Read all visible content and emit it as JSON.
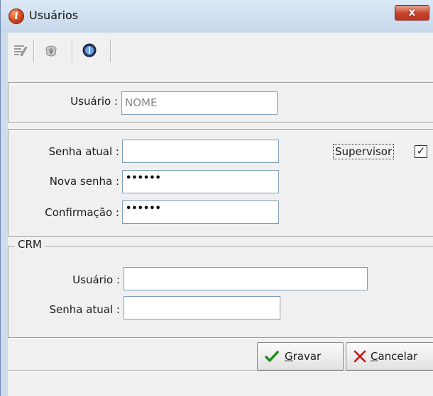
{
  "window": {
    "title": "Usuários",
    "close_label": "x"
  },
  "toolbar": {
    "icons": [
      "edit-icon",
      "lock-icon",
      "help-icon"
    ]
  },
  "user_section": {
    "usuario_label": "Usuário :",
    "usuario_value": "NOME"
  },
  "password_section": {
    "senha_atual_label": "Senha atual :",
    "senha_atual_value": "",
    "nova_senha_label": "Nova senha :",
    "nova_senha_value": "••••••",
    "confirmacao_label": "Confirmação :",
    "confirmacao_value": "••••••",
    "supervisor_label": "Supervisor",
    "supervisor_checked": "✓"
  },
  "crm_section": {
    "legend": "CRM",
    "usuario_label": "Usuário :",
    "usuario_value": "",
    "senha_atual_label": "Senha atual :",
    "senha_atual_value": ""
  },
  "buttons": {
    "gravar_accel": "G",
    "gravar_rest": "ravar",
    "cancelar_accel": "C",
    "cancelar_rest": "ancelar"
  },
  "colors": {
    "save_check": "#1e8a1e",
    "cancel_x": "#c0181c"
  }
}
